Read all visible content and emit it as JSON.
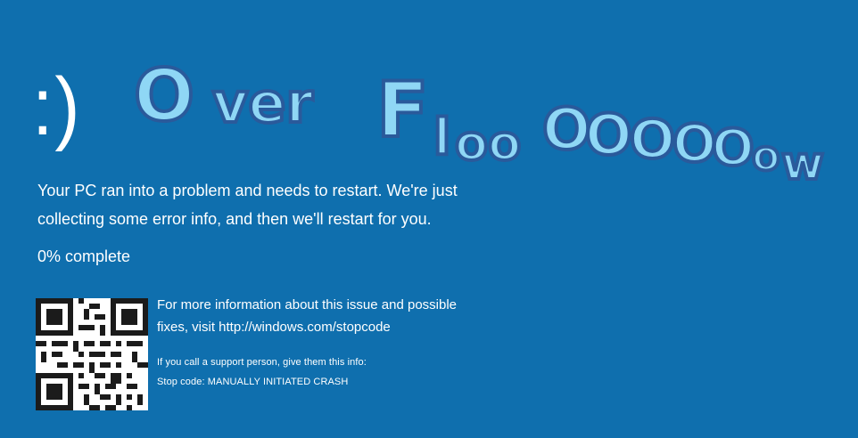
{
  "screen": {
    "emoticon": ":)",
    "overlay_text": {
      "big": "OverFlooOOOOOow",
      "parts": [
        "O",
        "ver",
        "F",
        "l",
        "oo",
        "O",
        "O",
        "O",
        "O",
        "O",
        "o",
        "w"
      ]
    },
    "message_line_1": "Your PC ran into a problem and needs to restart. We're just",
    "message_line_2": "collecting some error info, and then we'll restart for you.",
    "progress_text": "0% complete",
    "info_line_1": "For more information about this issue and possible",
    "info_line_2": "fixes, visit http://windows.com/stopcode",
    "support_line": "If you call a support person, give them this info:",
    "stop_code_line": "Stop code: MANUALLY INITIATED CRASH"
  },
  "colors": {
    "background": "#0f6fae",
    "text": "#ffffff",
    "overlay_fill": "#8fd7f5",
    "overlay_shadow": "#2a5a9b"
  }
}
